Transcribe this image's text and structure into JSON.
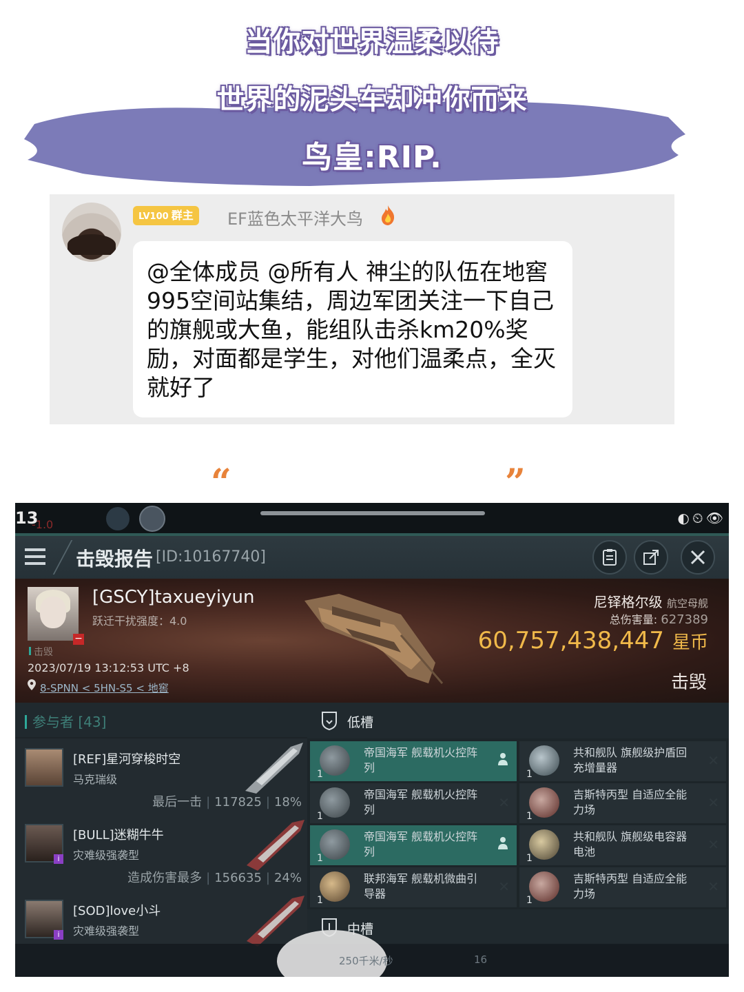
{
  "meme": {
    "line1": "当你对世界温柔以待",
    "line2": "世界的泥头车却冲你而来",
    "line3": "鸟皇:RIP.",
    "brush_color": "#7c7bb8"
  },
  "chat": {
    "level_badge": "LV100",
    "role_badge": "群主",
    "username": "EF蓝色太平洋大鸟",
    "message": "@全体成员 @所有人 神尘的队伍在地窖995空间站集结，周边军团关注一下自己的旗舰或大鱼，能组队击杀km20%奖励，对面都是学生，对他们温柔点，全灭就好了"
  },
  "quotes": {
    "open": "“",
    "close": "”"
  },
  "game": {
    "status": {
      "time": "13",
      "red_text": "-1.0",
      "icons": "◐⏲👁"
    },
    "title": "击毁报告",
    "report_id": "[ID:10167740]",
    "victim": {
      "name": "[GSCY]taxueyiyun",
      "warp": "跃迁干扰强度：4.0",
      "killed_label": "击毁",
      "time": "2023/07/19 13:12:53 UTC +8",
      "location": "8-SPNN < 5HN-S5 < 地窖",
      "ship_class": "尼铎格尔级",
      "ship_type": "航空母舰",
      "damage_label": "总伤害量:",
      "damage": "627389",
      "isk": "60,757,438,447",
      "currency": "星币",
      "status": "击毁"
    },
    "participants": {
      "header": "参与者 [43]",
      "rows": [
        {
          "name": "[REF]星河穿梭时空",
          "ship": "马克瑞级",
          "stat_label": "最后一击",
          "damage": "117825",
          "pct": "18%"
        },
        {
          "name": "[BULL]迷糊牛牛",
          "ship": "灾难级强袭型",
          "stat_label": "造成伤害最多",
          "damage": "156635",
          "pct": "24%"
        },
        {
          "name": "[SOD]love小斗",
          "ship": "灾难级强袭型",
          "stat_label": "",
          "damage": "",
          "pct": ""
        }
      ]
    },
    "low_slot": {
      "title": "低槽",
      "left": [
        {
          "name": "帝国海军 舰载机火控阵列",
          "qty": "1",
          "highlighted": true
        },
        {
          "name": "帝国海军 舰载机火控阵列",
          "qty": "1",
          "highlighted": false
        },
        {
          "name": "帝国海军 舰载机火控阵列",
          "qty": "1",
          "highlighted": true
        },
        {
          "name": "联邦海军 舰载机微曲引导器",
          "qty": "1",
          "highlighted": false
        }
      ],
      "right": [
        {
          "name": "共和舰队 旗舰级护盾回充增量器",
          "qty": "1"
        },
        {
          "name": "吉斯特丙型 自适应全能力场",
          "qty": "1"
        },
        {
          "name": "共和舰队 旗舰级电容器电池",
          "qty": "1"
        },
        {
          "name": "吉斯特丙型 自适应全能力场",
          "qty": "1"
        }
      ]
    },
    "mid_slot": {
      "title": "中槽"
    },
    "bottom": {
      "speed": "250千米/秒",
      "num": "16"
    }
  }
}
